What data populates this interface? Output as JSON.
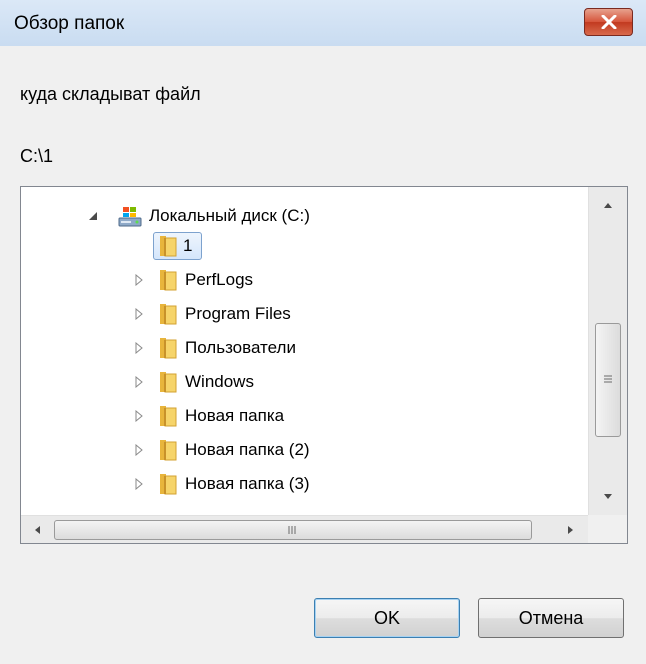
{
  "window": {
    "title": "Обзор папок"
  },
  "dialog": {
    "description": "куда складыват файл",
    "selected_path": "C:\\1"
  },
  "tree": {
    "drive_label": "Локальный диск (C:)",
    "folders": [
      {
        "label": "1",
        "selected": true,
        "expandable": false
      },
      {
        "label": "PerfLogs",
        "expandable": true
      },
      {
        "label": "Program Files",
        "expandable": true
      },
      {
        "label": "Пользователи",
        "expandable": true
      },
      {
        "label": "Windows",
        "expandable": true
      },
      {
        "label": "Новая папка",
        "expandable": true
      },
      {
        "label": "Новая папка (2)",
        "expandable": true
      },
      {
        "label": "Новая папка (3)",
        "expandable": true
      }
    ]
  },
  "buttons": {
    "ok": "OK",
    "cancel": "Отмена"
  },
  "colors": {
    "selection_border": "#7da2ce",
    "close_red": "#c23a20",
    "folder_yellow": "#f2c94c"
  }
}
